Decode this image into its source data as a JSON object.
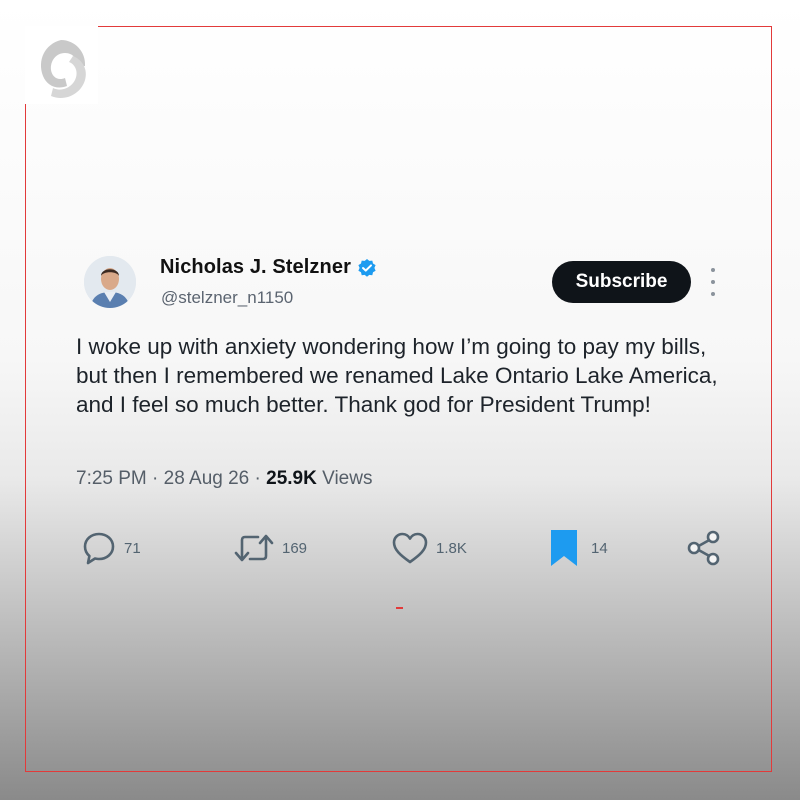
{
  "post": {
    "author_name": "Nicholas J. Stelzner",
    "handle": "@stelzner_n1150",
    "subscribe_label": "Subscribe",
    "text": "I woke up with anxiety wondering how I’m going to pay my bills, but then I remembered we renamed Lake Ontario Lake America, and I feel so much better. Thank god for President Trump!",
    "time": "7:25 PM",
    "date": "28 Aug 26",
    "views_count": "25.9K",
    "views_label": "Views",
    "separator": "·"
  },
  "actions": {
    "replies": "71",
    "reposts": "169",
    "likes": "1.8K",
    "bookmarks": "14"
  },
  "icons": {
    "logo": "channel-logo-icon",
    "verified": "verified-badge-icon",
    "more": "more-options-icon",
    "reply": "reply-icon",
    "repost": "repost-icon",
    "like": "heart-icon",
    "bookmark": "bookmark-icon",
    "share": "share-icon"
  },
  "colors": {
    "frame_accent": "#e23a3a",
    "verified_blue": "#1d9bf0",
    "bookmark_blue": "#1d9bf0",
    "button_dark": "#0f1419"
  }
}
